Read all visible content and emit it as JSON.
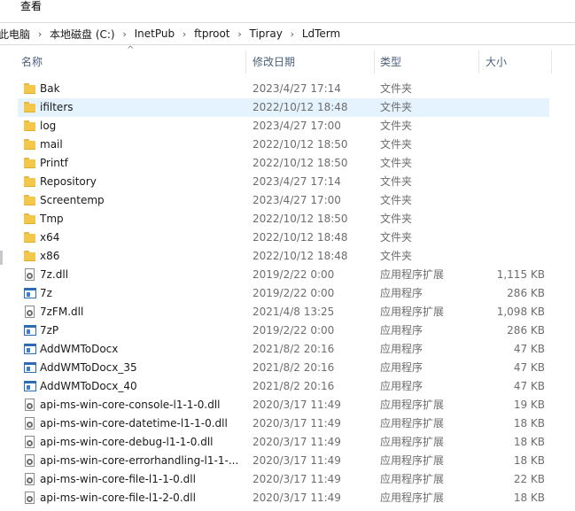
{
  "menu": {
    "view": "查看"
  },
  "address": {
    "crumbs": [
      "此电脑",
      "本地磁盘 (C:)",
      "InetPub",
      "ftproot",
      "Tipray",
      "LdTerm"
    ],
    "separator": "›"
  },
  "columns": {
    "name": "名称",
    "date": "修改日期",
    "type": "类型",
    "size": "大小"
  },
  "files": [
    {
      "name": "Bak",
      "date": "2023/4/27 17:14",
      "type": "文件夹",
      "size": "",
      "icon": "folder-icon"
    },
    {
      "name": "ifilters",
      "date": "2022/10/12 18:48",
      "type": "文件夹",
      "size": "",
      "icon": "folder-icon",
      "selected": true
    },
    {
      "name": "log",
      "date": "2023/4/27 17:00",
      "type": "文件夹",
      "size": "",
      "icon": "folder-icon"
    },
    {
      "name": "mail",
      "date": "2022/10/12 18:50",
      "type": "文件夹",
      "size": "",
      "icon": "folder-icon"
    },
    {
      "name": "Printf",
      "date": "2022/10/12 18:50",
      "type": "文件夹",
      "size": "",
      "icon": "folder-icon"
    },
    {
      "name": "Repository",
      "date": "2023/4/27 17:14",
      "type": "文件夹",
      "size": "",
      "icon": "folder-icon"
    },
    {
      "name": "Screentemp",
      "date": "2023/4/27 17:00",
      "type": "文件夹",
      "size": "",
      "icon": "folder-icon"
    },
    {
      "name": "Tmp",
      "date": "2022/10/12 18:50",
      "type": "文件夹",
      "size": "",
      "icon": "folder-icon"
    },
    {
      "name": "x64",
      "date": "2022/10/12 18:48",
      "type": "文件夹",
      "size": "",
      "icon": "folder-icon"
    },
    {
      "name": "x86",
      "date": "2022/10/12 18:48",
      "type": "文件夹",
      "size": "",
      "icon": "folder-icon"
    },
    {
      "name": "7z.dll",
      "date": "2019/2/22 0:00",
      "type": "应用程序扩展",
      "size": "1,115 KB",
      "icon": "dll-icon"
    },
    {
      "name": "7z",
      "date": "2019/2/22 0:00",
      "type": "应用程序",
      "size": "286 KB",
      "icon": "exe-icon"
    },
    {
      "name": "7zFM.dll",
      "date": "2021/4/8 13:25",
      "type": "应用程序扩展",
      "size": "1,098 KB",
      "icon": "dll-icon"
    },
    {
      "name": "7zP",
      "date": "2019/2/22 0:00",
      "type": "应用程序",
      "size": "286 KB",
      "icon": "exe-icon"
    },
    {
      "name": "AddWMToDocx",
      "date": "2021/8/2 20:16",
      "type": "应用程序",
      "size": "47 KB",
      "icon": "exe-icon"
    },
    {
      "name": "AddWMToDocx_35",
      "date": "2021/8/2 20:16",
      "type": "应用程序",
      "size": "47 KB",
      "icon": "exe-icon"
    },
    {
      "name": "AddWMToDocx_40",
      "date": "2021/8/2 20:16",
      "type": "应用程序",
      "size": "47 KB",
      "icon": "exe-icon"
    },
    {
      "name": "api-ms-win-core-console-l1-1-0.dll",
      "date": "2020/3/17 11:49",
      "type": "应用程序扩展",
      "size": "19 KB",
      "icon": "dll-icon"
    },
    {
      "name": "api-ms-win-core-datetime-l1-1-0.dll",
      "date": "2020/3/17 11:49",
      "type": "应用程序扩展",
      "size": "18 KB",
      "icon": "dll-icon"
    },
    {
      "name": "api-ms-win-core-debug-l1-1-0.dll",
      "date": "2020/3/17 11:49",
      "type": "应用程序扩展",
      "size": "18 KB",
      "icon": "dll-icon"
    },
    {
      "name": "api-ms-win-core-errorhandling-l1-1-...",
      "date": "2020/3/17 11:49",
      "type": "应用程序扩展",
      "size": "18 KB",
      "icon": "dll-icon"
    },
    {
      "name": "api-ms-win-core-file-l1-1-0.dll",
      "date": "2020/3/17 11:49",
      "type": "应用程序扩展",
      "size": "22 KB",
      "icon": "dll-icon"
    },
    {
      "name": "api-ms-win-core-file-l1-2-0.dll",
      "date": "2020/3/17 11:49",
      "type": "应用程序扩展",
      "size": "18 KB",
      "icon": "dll-icon"
    }
  ]
}
